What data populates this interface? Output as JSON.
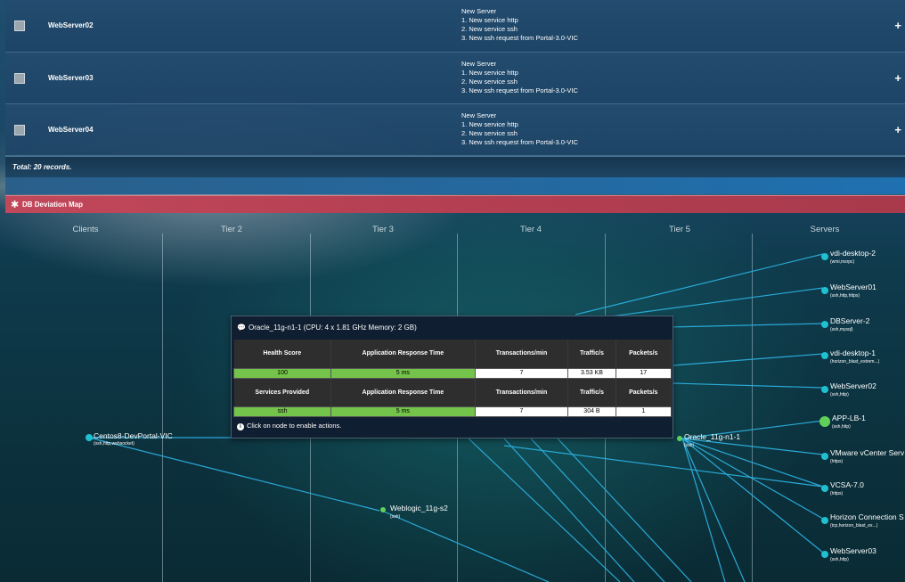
{
  "records": [
    {
      "name": "WebServer02",
      "changes": [
        "New Server",
        "1. New service http",
        "2. New service ssh",
        "3. New ssh request from Portal-3.0-VIC"
      ],
      "action": "+"
    },
    {
      "name": "WebServer03",
      "changes": [
        "New Server",
        "1. New service http",
        "2. New service ssh",
        "3. New ssh request from Portal-3.0-VIC"
      ],
      "action": "+"
    },
    {
      "name": "WebServer04",
      "changes": [
        "New Server",
        "1. New service http",
        "2. New service ssh",
        "3. New ssh request from Portal-3.0-VIC"
      ],
      "action": "+"
    }
  ],
  "total_text": "Total: 20 records.",
  "map": {
    "title": "DB Deviation Map",
    "tiers": [
      "Clients",
      "Tier 2",
      "Tier 3",
      "Tier 4",
      "Tier 5",
      "Servers"
    ],
    "client_node": {
      "name": "Centos8-DevPortal-VIC",
      "services": "(ssh,http,websocket)"
    },
    "tier3_node": {
      "name": "Weblogic_11g-s2",
      "services": "(ssh)"
    },
    "tier5_node": {
      "name": "Oracle_11g-n1-1",
      "services": "(ssh)"
    },
    "servers": [
      {
        "name": "vdi-desktop-2",
        "services": "(wmi,msrpc)"
      },
      {
        "name": "WebServer01",
        "services": "(ssh,http,https)"
      },
      {
        "name": "DBServer-2",
        "services": "(ssh,mysql)"
      },
      {
        "name": "vdi-desktop-1",
        "services": "(horizon_blast_extrem...)"
      },
      {
        "name": "WebServer02",
        "services": "(ssh,http)"
      },
      {
        "name": "APP-LB-1",
        "services": "(ssh,http)"
      },
      {
        "name": "VMware vCenter Serv",
        "services": "(https)"
      },
      {
        "name": "VCSA-7.0",
        "services": "(https)"
      },
      {
        "name": "Horizon Connection S",
        "services": "(tcp,horizon_blast_ex...)"
      },
      {
        "name": "WebServer03",
        "services": "(ssh,http)"
      }
    ]
  },
  "tooltip": {
    "header": "Oracle_11g-n1-1 (CPU: 4 x 1.81 GHz Memory: 2 GB)",
    "headers1": [
      "Health Score",
      "Application Response Time",
      "Transactions/min",
      "Traffic/s",
      "Packets/s"
    ],
    "values1": [
      "100",
      "5 ms",
      "7",
      "3.53 KB",
      "17"
    ],
    "headers2": [
      "Services Provided",
      "Application Response Time",
      "Transactions/min",
      "Traffic/s",
      "Packets/s"
    ],
    "values2": [
      "ssh",
      "5 ms",
      "7",
      "304 B",
      "1"
    ],
    "footer": "Click on node to enable actions."
  },
  "colors": {
    "node": "#5fd15a",
    "link": "#2aa9d6",
    "header_bar": "#b43f52",
    "green_cell": "#74c34a"
  }
}
